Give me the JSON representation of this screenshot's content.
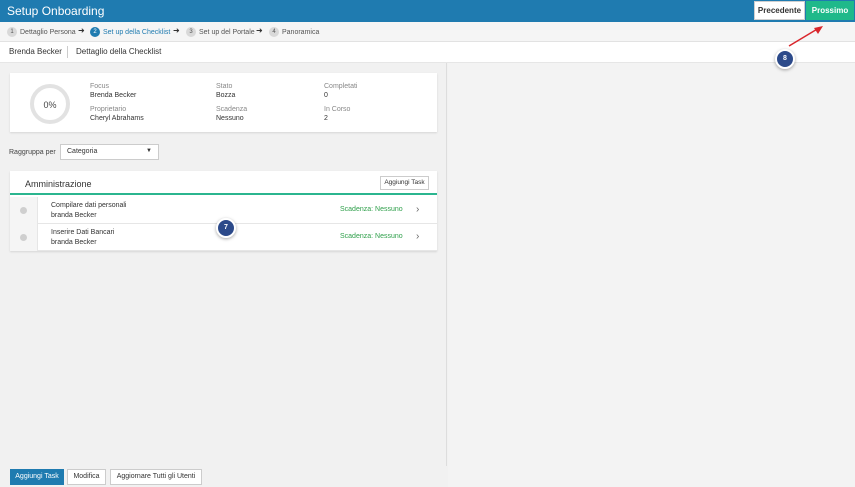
{
  "header": {
    "title": "Setup Onboarding",
    "prev_label": "Precedente",
    "next_label": "Prossimo"
  },
  "steps": [
    {
      "num": "1",
      "label": "Dettaglio Persona"
    },
    {
      "num": "2",
      "label": "Set up della Checklist"
    },
    {
      "num": "3",
      "label": "Set up del Portale"
    },
    {
      "num": "4",
      "label": "Panoramica"
    }
  ],
  "breadcrumb": {
    "person": "Brenda Becker",
    "page": "Dettaglio della Checklist"
  },
  "summary": {
    "percent": "0%",
    "focus_label": "Focus",
    "focus_value": "Brenda Becker",
    "owner_label": "Proprietario",
    "owner_value": "Cheryl Abrahams",
    "status_label": "Stato",
    "status_value": "Bozza",
    "due_label": "Scadenza",
    "due_value": "Nessuno",
    "completed_label": "Completati",
    "completed_value": "0",
    "inprogress_label": "In Corso",
    "inprogress_value": "2"
  },
  "grouping": {
    "label": "Raggruppa per",
    "selected": "Categoria"
  },
  "panel": {
    "title": "Amministrazione",
    "add_task_label": "Aggiungi Task",
    "tasks": [
      {
        "name": "Compilare dati personali",
        "assignee": "branda Becker",
        "due": "Scadenza: Nessuno"
      },
      {
        "name": "Inserire Dati Bancari",
        "assignee": "branda Becker",
        "due": "Scadenza: Nessuno"
      }
    ]
  },
  "callouts": {
    "badge_7": "7",
    "badge_8": "8",
    "arrow_color": "#d9262c"
  },
  "footer": {
    "add_task": "Aggiungi Task",
    "edit": "Modifica",
    "update_all": "Aggiornare Tutti gli Utenti"
  },
  "colors": {
    "header_bg": "#1f7bb0",
    "next_btn": "#1fb98a",
    "accent_line": "#2bb58f",
    "due_text": "#2e9f4a",
    "badge": "#2c4a8a"
  }
}
